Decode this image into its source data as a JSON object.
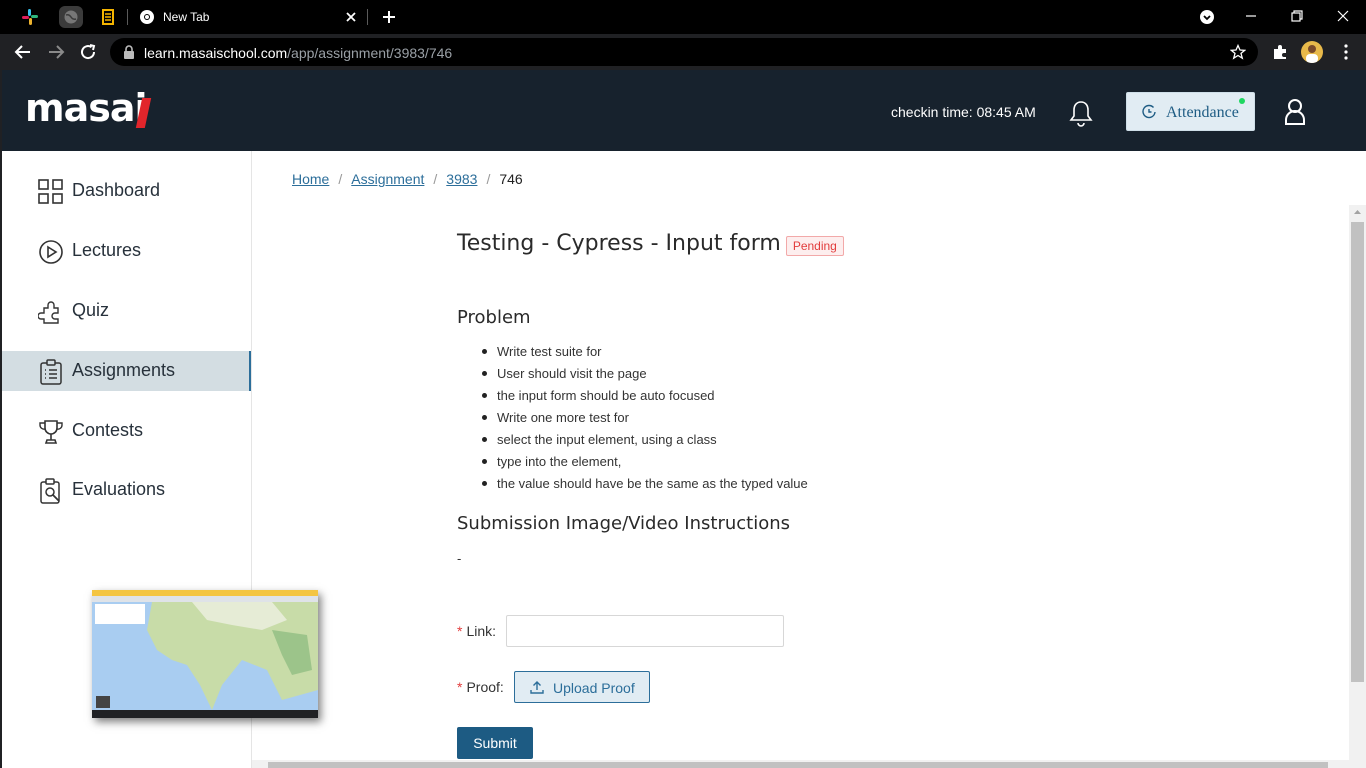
{
  "browser": {
    "tab_title": "New Tab",
    "url_domain": "learn.masaischool.com",
    "url_path": "/app/assignment/3983/746"
  },
  "header": {
    "logo": "masai",
    "checkin_label": "checkin time: 08:45 AM",
    "attendance_label": "Attendance",
    "attendance_status_color": "#1ed760"
  },
  "sidebar": {
    "items": [
      {
        "label": "Dashboard",
        "icon": "grid-icon"
      },
      {
        "label": "Lectures",
        "icon": "play-circle-icon"
      },
      {
        "label": "Quiz",
        "icon": "puzzle-icon"
      },
      {
        "label": "Assignments",
        "icon": "clipboard-list-icon",
        "active": true
      },
      {
        "label": "Contests",
        "icon": "trophy-icon"
      },
      {
        "label": "Evaluations",
        "icon": "clipboard-search-icon"
      }
    ]
  },
  "breadcrumb": {
    "items": [
      "Home",
      "Assignment",
      "3983"
    ],
    "current": "746"
  },
  "assignment": {
    "title": "Testing - Cypress - Input form",
    "status": "Pending",
    "status_color": "#e23c3c",
    "problem_heading": "Problem",
    "problem_items": [
      "Write test suite for",
      "User should visit the page",
      "the input form should be auto focused",
      "Write one more test for",
      "select the input element, using a class",
      "type into the element,",
      "the value should have be the same as the typed value"
    ],
    "instructions_heading": "Submission Image/Video Instructions",
    "instructions_text": "-"
  },
  "form": {
    "link_label": "Link",
    "link_value": "",
    "proof_label": "Proof",
    "upload_label": "Upload Proof",
    "submit_label": "Submit",
    "required_marker": "*"
  },
  "colors": {
    "header_bg": "#17222d",
    "accent": "#1d5b83",
    "active_nav_bg": "#d3dde2"
  }
}
